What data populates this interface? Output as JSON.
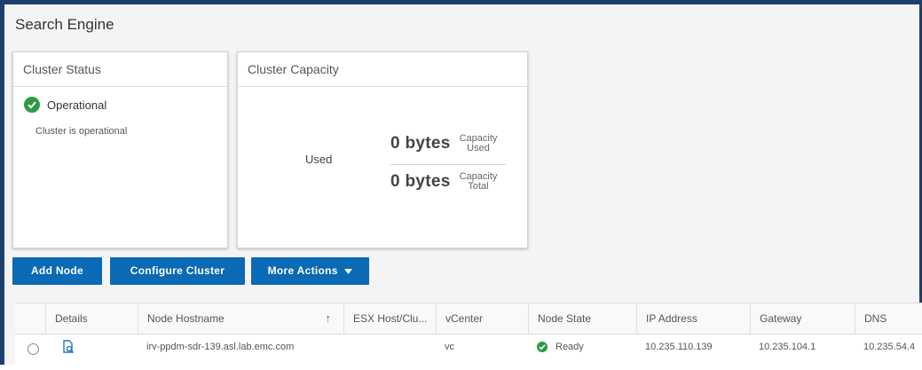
{
  "page": {
    "title": "Search Engine"
  },
  "cluster_status": {
    "title": "Cluster Status",
    "status": "Operational",
    "description": "Cluster is operational",
    "status_icon": "check-circle-icon",
    "status_color": "#2e9a43"
  },
  "cluster_capacity": {
    "title": "Cluster Capacity",
    "used_label": "Used",
    "capacity_used_value": "0 bytes",
    "capacity_used_label_line1": "Capacity",
    "capacity_used_label_line2": "Used",
    "capacity_total_value": "0 bytes",
    "capacity_total_label_line1": "Capacity",
    "capacity_total_label_line2": "Total"
  },
  "actions": {
    "add_node": "Add Node",
    "configure_cluster": "Configure Cluster",
    "more_actions": "More Actions",
    "more_actions_icon": "caret-down-icon",
    "button_color": "#0a6ab5"
  },
  "grid": {
    "columns": {
      "details": "Details",
      "node_hostname": "Node Hostname",
      "sort_icon": "↑",
      "esx_host": "ESX Host/Clu...",
      "vcenter": "vCenter",
      "node_state": "Node State",
      "ip_address": "IP Address",
      "gateway": "Gateway",
      "dns": "DNS"
    },
    "rows": [
      {
        "node_hostname": "irv-ppdm-sdr-139.asl.lab.emc.com",
        "esx_host": "",
        "vcenter": "vc",
        "node_state": "Ready",
        "ip_address": "10.235.110.139",
        "gateway": "10.235.104.1",
        "dns": "10.235.54.4"
      }
    ]
  }
}
